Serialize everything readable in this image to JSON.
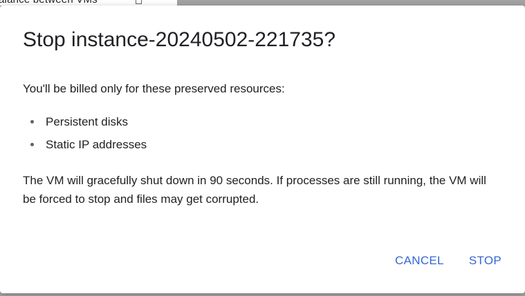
{
  "background": {
    "partial_text": "alance between VMs"
  },
  "dialog": {
    "title": "Stop instance-20240502-221735?",
    "intro": "You'll be billed only for these preserved resources:",
    "resources": [
      "Persistent disks",
      "Static IP addresses"
    ],
    "warning": "The VM will gracefully shut down in 90 seconds. If processes are still running, the VM will be forced to stop and files may get corrupted.",
    "cancel_label": "CANCEL",
    "stop_label": "STOP"
  },
  "colors": {
    "accent": "#3367d6",
    "text": "#202124",
    "backdrop": "#a3a3a3"
  }
}
